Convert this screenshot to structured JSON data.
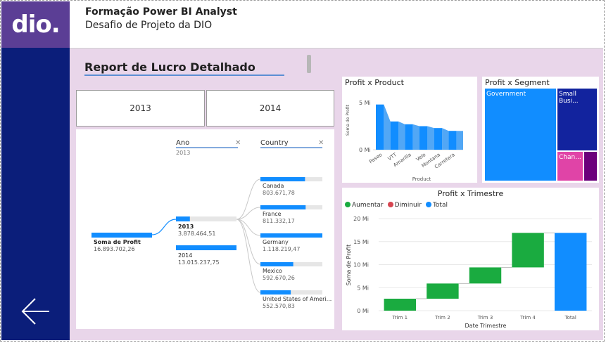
{
  "header": {
    "logo_text": "dio.",
    "title": "Formação Power BI Analyst",
    "subtitle": "Desafio de Projeto da DIO"
  },
  "report": {
    "title": "Report de Lucro Detalhado"
  },
  "slicers": [
    {
      "label": "2013"
    },
    {
      "label": "2014"
    }
  ],
  "colors": {
    "sidebar": "#0b1e7a",
    "logo_bg": "#5b3e95",
    "accent": "#118dff",
    "increase": "#1aab40",
    "decrease": "#d64550",
    "total": "#118dff",
    "canvas": "#e9d6ea"
  },
  "icons": {
    "back": "arrow-left-icon"
  },
  "decomp": {
    "levels": [
      {
        "name": "Ano",
        "filter": "2013"
      },
      {
        "name": "Country",
        "filter": ""
      }
    ],
    "root": {
      "label": "Soma de Profit",
      "value": "16.893.702,26"
    },
    "years": [
      {
        "label": "2013",
        "value": "3.878.464,51",
        "share": 0.23,
        "selected": true
      },
      {
        "label": "2014",
        "value": "13.015.237,75",
        "share": 0.77,
        "selected": false
      }
    ],
    "countries": [
      {
        "label": "Canada",
        "value": "803.671,78",
        "share": 0.72
      },
      {
        "label": "France",
        "value": "811.332,17",
        "share": 0.73
      },
      {
        "label": "Germany",
        "value": "1.118.219,47",
        "share": 1.0
      },
      {
        "label": "Mexico",
        "value": "592.670,26",
        "share": 0.53
      },
      {
        "label": "United States of Ameri...",
        "value": "552.570,83",
        "share": 0.49
      }
    ]
  },
  "product_chart": {
    "title": "Profit x Product",
    "chart_data": {
      "type": "area",
      "ylabel": "Soma de Profit",
      "xlabel": "Product",
      "y_ticks": [
        "5 Mi",
        "0 Mi"
      ],
      "ylim": [
        0,
        5
      ],
      "categories": [
        "Paseo",
        "VTT",
        "Amarilla",
        "Velo",
        "Montana",
        "Carretera"
      ],
      "values": [
        4.8,
        3.0,
        2.7,
        2.5,
        2.3,
        2.0
      ]
    }
  },
  "segment_chart": {
    "title": "Profit x Segment",
    "chart_data": {
      "type": "treemap",
      "categories": [
        "Government",
        "Small Busi...",
        "Chan...",
        ""
      ],
      "values": [
        11.4,
        4.14,
        1.31,
        0.58
      ]
    }
  },
  "quarter_chart": {
    "title": "Profit x Trimestre",
    "legend": [
      {
        "label": "Aumentar",
        "color": "#1aab40"
      },
      {
        "label": "Diminuir",
        "color": "#d64550"
      },
      {
        "label": "Total",
        "color": "#118dff"
      }
    ],
    "chart_data": {
      "type": "waterfall",
      "ylabel": "Soma de Profit",
      "xlabel": "Date Trimestre",
      "y_ticks": [
        "20 Mi",
        "15 Mi",
        "10 Mi",
        "5 Mi",
        "0 Mi"
      ],
      "ylim": [
        0,
        20
      ],
      "categories": [
        "Trim 1",
        "Trim 2",
        "Trim 3",
        "Trim 4",
        "Total"
      ],
      "values": [
        2.6,
        3.3,
        3.5,
        7.5,
        16.9
      ]
    }
  }
}
